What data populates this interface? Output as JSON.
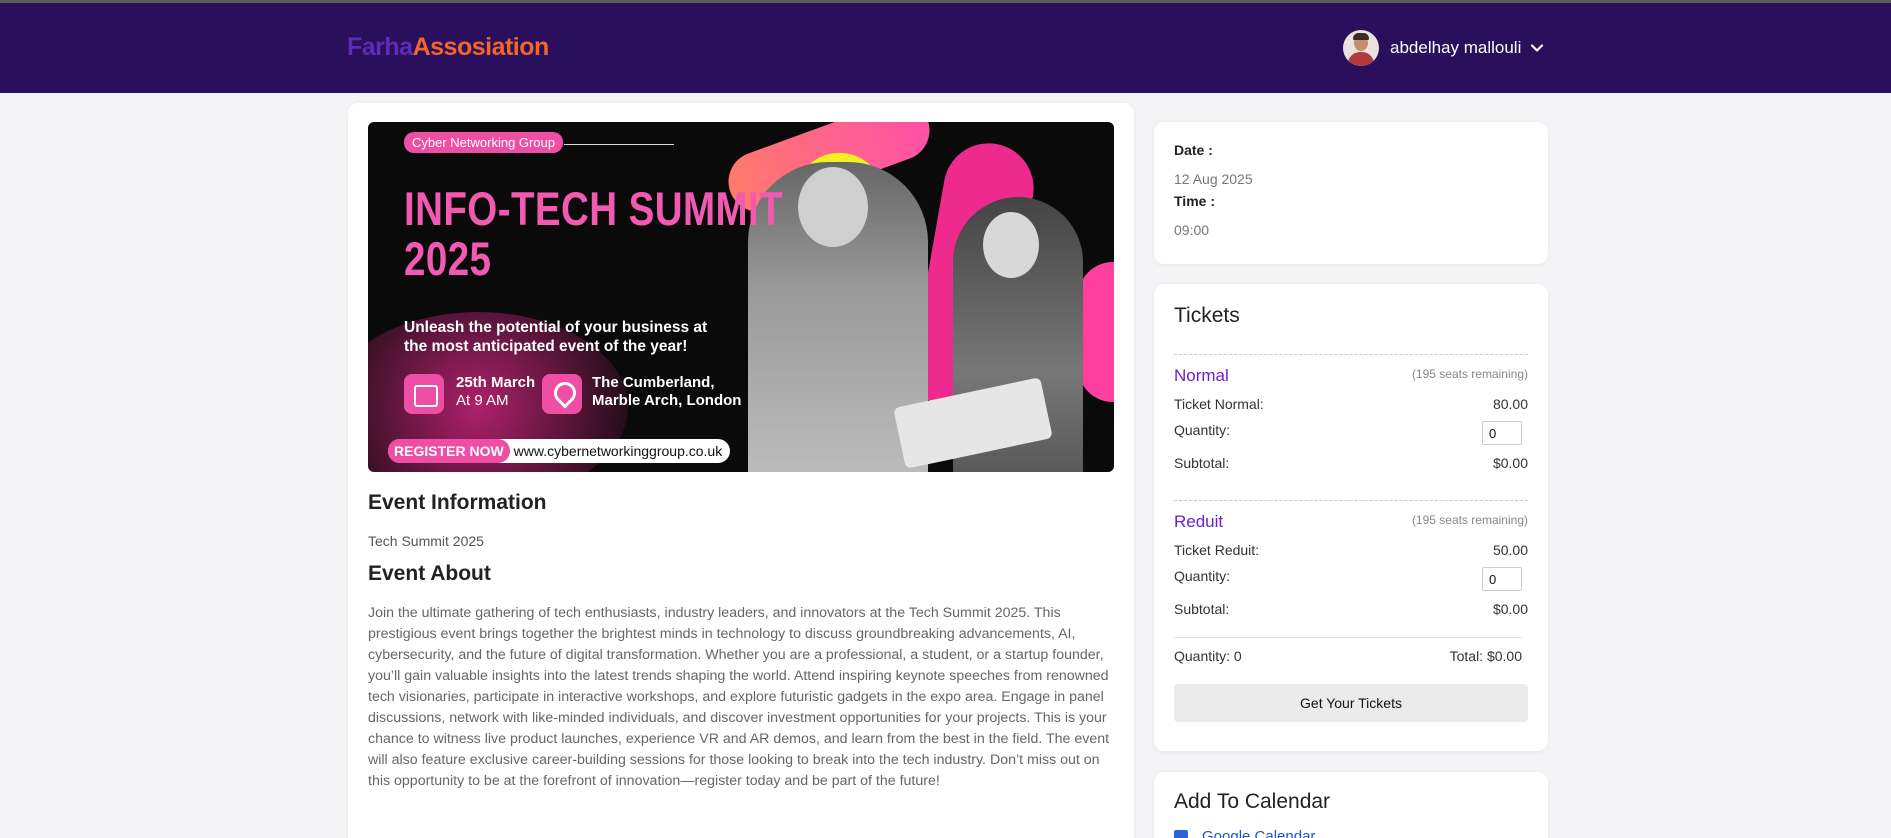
{
  "header": {
    "logo_part1": "Farha",
    "logo_part2": "Assosiation",
    "user_name": "abdelhay mallouli"
  },
  "banner": {
    "tag": "Cyber Networking Group",
    "title_line1": "INFO-TECH SUMMIT",
    "title_line2": "2025",
    "subtitle": "Unleash the potential of your business at the most anticipated event of the year!",
    "date_line1": "25th March",
    "date_line2": "At 9 AM",
    "location_line1": "The Cumberland,",
    "location_line2": "Marble Arch, London",
    "register_label": "REGISTER NOW",
    "url": "www.cybernetworkinggroup.co.uk"
  },
  "event": {
    "info_heading": "Event Information",
    "name": "Tech Summit 2025",
    "about_heading": "Event About",
    "about_text": "Join the ultimate gathering of tech enthusiasts, industry leaders, and innovators at the Tech Summit 2025. This prestigious event brings together the brightest minds in technology to discuss groundbreaking advancements, AI, cybersecurity, and the future of digital transformation. Whether you are a professional, a student, or a startup founder, you’ll gain valuable insights into the latest trends shaping the world. Attend inspiring keynote speeches from renowned tech visionaries, participate in interactive workshops, and explore futuristic gadgets in the expo area. Engage in panel discussions, network with like-minded individuals, and discover investment opportunities for your projects. This is your chance to witness live product launches, experience VR and AR demos, and learn from the best in the field. The event will also feature exclusive career-building sessions for those looking to break into the tech industry. Don’t miss out on this opportunity to be at the forefront of innovation—register today and be part of the future!"
  },
  "datetime": {
    "date_label": "Date :",
    "date_value": "12 Aug 2025",
    "time_label": "Time :",
    "time_value": "09:00"
  },
  "tickets": {
    "heading": "Tickets",
    "types": [
      {
        "name": "Normal",
        "seats": "(195 seats remaining)",
        "price_label": "Ticket Normal:",
        "price": "80.00",
        "quantity_label": "Quantity:",
        "quantity": "0",
        "subtotal_label": "Subtotal:",
        "subtotal": "$0.00"
      },
      {
        "name": "Reduit",
        "seats": "(195 seats remaining)",
        "price_label": "Ticket Reduit:",
        "price": "50.00",
        "quantity_label": "Quantity:",
        "quantity": "0",
        "subtotal_label": "Subtotal:",
        "subtotal": "$0.00"
      }
    ],
    "total_quantity": "Quantity: 0",
    "total": "Total: $0.00",
    "button_label": "Get Your Tickets"
  },
  "calendar": {
    "heading": "Add To Calendar",
    "google_label": "Google Calendar"
  },
  "colors": {
    "header_bg": "#2a0f5c",
    "logo_purple": "#5f2bb8",
    "logo_orange": "#f2662a",
    "ticket_name": "#6a1fd6",
    "banner_pink": "#ee4fa4"
  }
}
